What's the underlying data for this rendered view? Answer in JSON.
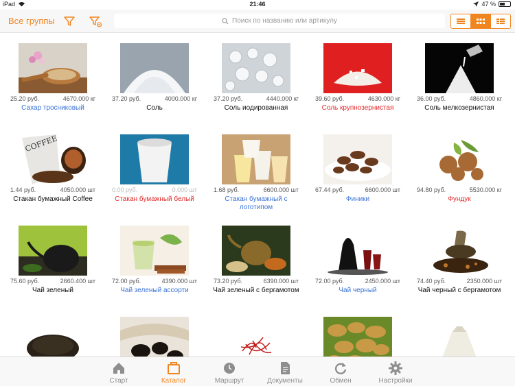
{
  "status_bar": {
    "device": "iPad",
    "time": "21:46",
    "battery": "47 %",
    "battery_level": 0.47
  },
  "toolbar": {
    "groups_label": "Все группы",
    "search_placeholder": "Поиск по названию или артикулу",
    "accent": "#f0851f",
    "view_modes": [
      "list-view-icon",
      "grid-view-icon",
      "table-view-icon"
    ],
    "active_view": 1
  },
  "products": [
    {
      "price": "25.20 руб.",
      "qty": "4670.000 кг",
      "name": "Сахар тросниковый",
      "color": "blue",
      "img": "cane-sugar"
    },
    {
      "price": "37.20 руб.",
      "qty": "4000.000 кг",
      "name": "Соль",
      "color": "black",
      "img": "salt"
    },
    {
      "price": "37.20 руб.",
      "qty": "4440.000 кг",
      "name": "Соль иодированная",
      "color": "black",
      "img": "iodized-salt"
    },
    {
      "price": "39.60 руб.",
      "qty": "4630.000 кг",
      "name": "Соль крупнозернистая",
      "color": "red",
      "img": "coarse-salt"
    },
    {
      "price": "36.00 руб.",
      "qty": "4860.000 кг",
      "name": "Соль мелкозернистая",
      "color": "black",
      "img": "fine-salt"
    },
    {
      "price": "1.44 руб.",
      "qty": "4050.000 шт",
      "name": "Стакан бумажный Coffee",
      "color": "black",
      "img": "coffee-cup"
    },
    {
      "price": "0.00 руб.",
      "qty": "0.000 шт",
      "name": "Стакан бумажный белый",
      "color": "red",
      "img": "white-cup",
      "dim": true
    },
    {
      "price": "1.68 руб.",
      "qty": "6600.000 шт",
      "name": "Стакан бумажный с логотипом",
      "color": "blue",
      "img": "logo-cups"
    },
    {
      "price": "67.44 руб.",
      "qty": "6600.000 шт",
      "name": "Финики",
      "color": "blue",
      "img": "dates"
    },
    {
      "price": "94.80 руб.",
      "qty": "5530.000 кг",
      "name": "Фундук",
      "color": "red",
      "img": "hazelnuts"
    },
    {
      "price": "75.60 руб.",
      "qty": "2660.400 шт",
      "name": "Чай зеленый",
      "color": "black",
      "img": "green-tea"
    },
    {
      "price": "72.00 руб.",
      "qty": "4390.000 шт",
      "name": "Чай зеленый ассорти",
      "color": "blue",
      "img": "green-tea-assorted"
    },
    {
      "price": "73.20 руб.",
      "qty": "6390.000 шт",
      "name": "Чай зеленый с бергамотом",
      "color": "black",
      "img": "green-tea-bergamot"
    },
    {
      "price": "72.00 руб.",
      "qty": "2450.000 шт",
      "name": "Чай черный",
      "color": "blue",
      "img": "black-tea"
    },
    {
      "price": "74.40 руб.",
      "qty": "2350.000 шт",
      "name": "Чай черный с бергамотом",
      "color": "black",
      "img": "black-tea-bergamot"
    },
    {
      "img": "loose-tea"
    },
    {
      "img": "dried-fruit"
    },
    {
      "img": "saffron"
    },
    {
      "img": "dried-apples"
    },
    {
      "img": "sugar-bag"
    }
  ],
  "tabs": [
    {
      "label": "Старт",
      "icon": "home-icon"
    },
    {
      "label": "Каталог",
      "icon": "catalog-icon",
      "active": true
    },
    {
      "label": "Маршрут",
      "icon": "route-clock-icon"
    },
    {
      "label": "Документы",
      "icon": "documents-icon"
    },
    {
      "label": "Обмен",
      "icon": "sync-icon"
    },
    {
      "label": "Настройки",
      "icon": "settings-gear-icon"
    }
  ]
}
